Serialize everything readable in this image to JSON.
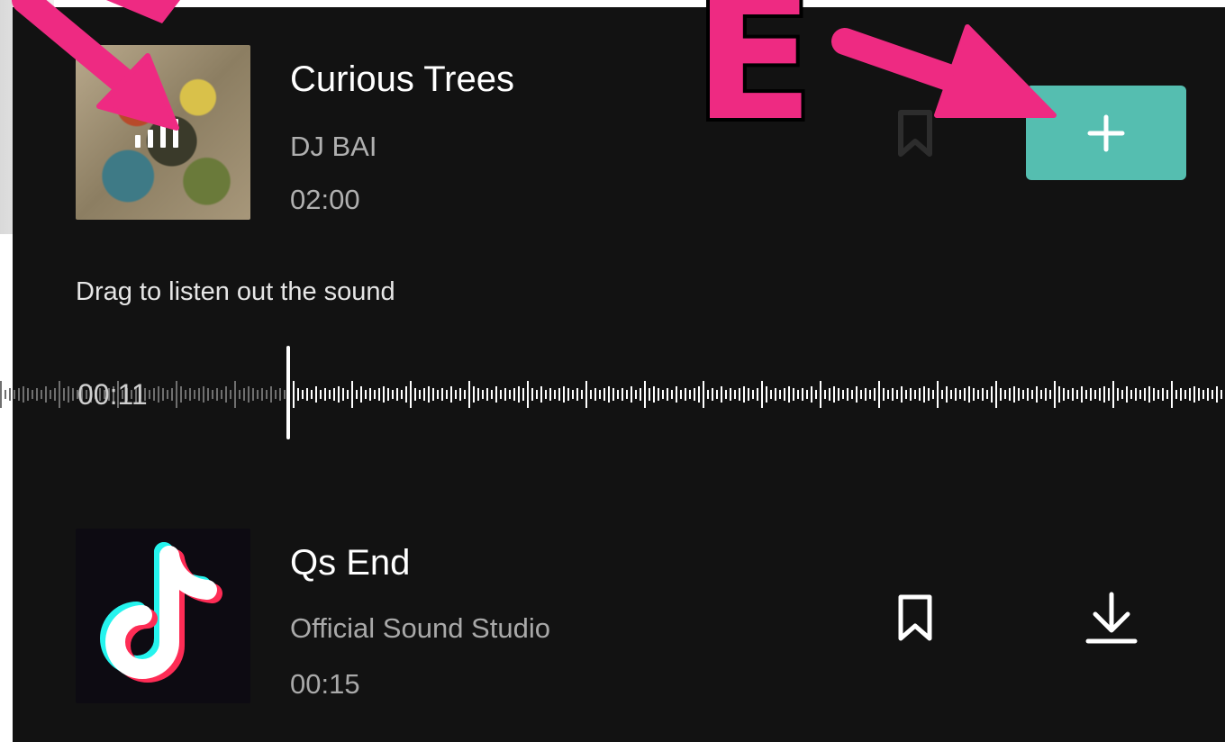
{
  "tracks": [
    {
      "title": "Curious Trees",
      "artist": "DJ BAI",
      "duration": "02:00",
      "state": "playing",
      "actions": {
        "bookmark_icon": "bookmark-outline-icon",
        "add_icon": "plus-icon"
      }
    },
    {
      "title": "Qs End",
      "artist": "Official Sound Studio",
      "duration": "00:15",
      "actions": {
        "bookmark_icon": "bookmark-outline-icon",
        "download_icon": "download-icon"
      }
    }
  ],
  "scrubber": {
    "hint": "Drag to listen out the sound",
    "position": "00:11"
  },
  "annotation": {
    "letter": "E",
    "color": "#ee2a82"
  },
  "colors": {
    "background": "#121212",
    "accent": "#55beb0",
    "secondary_text": "#a9a9a9"
  }
}
